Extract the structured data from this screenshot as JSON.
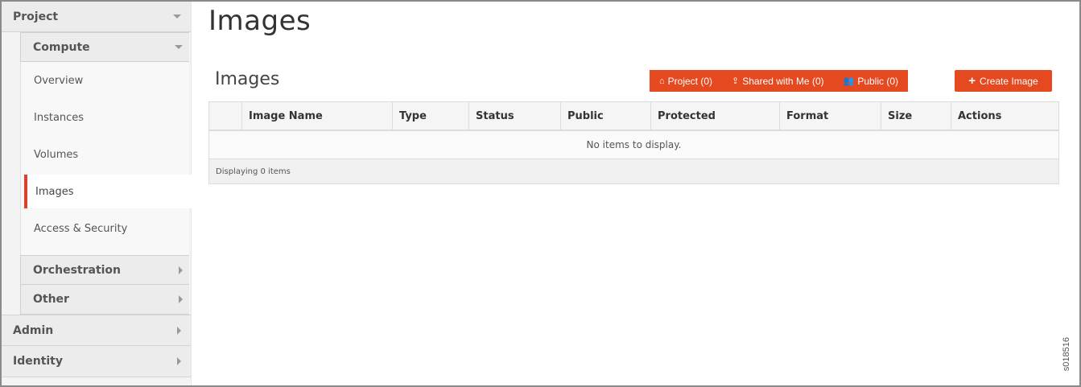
{
  "sidebar": {
    "project_label": "Project",
    "compute_label": "Compute",
    "compute_items": [
      {
        "label": "Overview"
      },
      {
        "label": "Instances"
      },
      {
        "label": "Volumes"
      },
      {
        "label": "Images",
        "active": true
      },
      {
        "label": "Access & Security"
      }
    ],
    "orchestration_label": "Orchestration",
    "other_label": "Other",
    "admin_label": "Admin",
    "identity_label": "Identity"
  },
  "main": {
    "page_title": "Images",
    "section_title": "Images",
    "filters": [
      {
        "icon": "home-icon",
        "glyph": "⌂",
        "label": "Project (0)"
      },
      {
        "icon": "share-icon",
        "glyph": "⇪",
        "label": "Shared with Me (0)"
      },
      {
        "icon": "users-icon",
        "glyph": "👥",
        "label": "Public (0)"
      }
    ],
    "create_label": "Create Image",
    "table": {
      "columns": [
        "",
        "Image Name",
        "Type",
        "Status",
        "Public",
        "Protected",
        "Format",
        "Size",
        "Actions"
      ],
      "empty_message": "No items to display.",
      "footer": "Displaying 0 items"
    }
  },
  "figure_code": "s018516",
  "colors": {
    "accent": "#e4491f",
    "active_marker": "#d9432c"
  }
}
